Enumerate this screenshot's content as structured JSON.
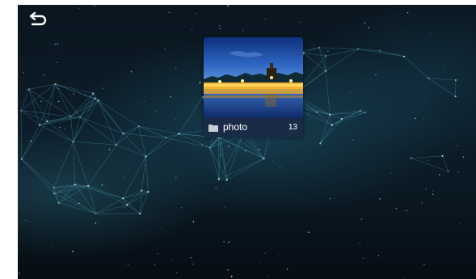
{
  "toolbar": {
    "back_icon": "back-arrow-icon"
  },
  "albums": [
    {
      "name": "photo",
      "count": "13",
      "icon": "folder-icon"
    }
  ],
  "colors": {
    "background": "#0a1620",
    "card_footer": "#1a2b48",
    "text": "#ffffff",
    "network_accent": "#5fc0d8"
  }
}
